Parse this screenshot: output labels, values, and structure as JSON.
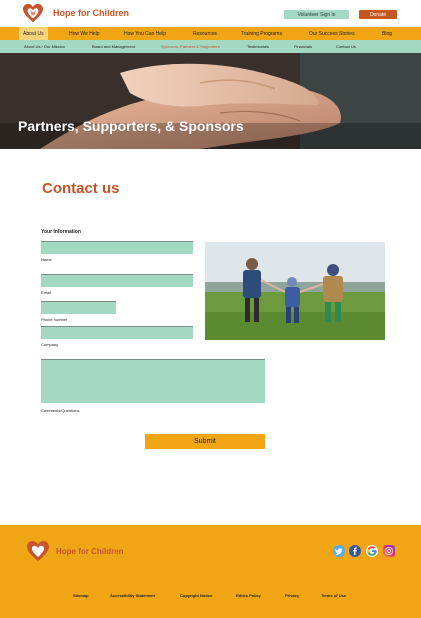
{
  "header": {
    "brand": "Hope for Children",
    "volunteer_label": "Volunteer Sign in",
    "donate_label": "Donate"
  },
  "main_nav": [
    {
      "label": "About Us",
      "active": true
    },
    {
      "label": "How We Help"
    },
    {
      "label": "How You Can Help"
    },
    {
      "label": "Resources"
    },
    {
      "label": "Training Programs"
    },
    {
      "label": "Our Success Stories"
    },
    {
      "label": "Blog"
    }
  ],
  "sub_nav": [
    {
      "label": "About Us / Our Mission"
    },
    {
      "label": "Board and Management"
    },
    {
      "label": "Sponsors, Partners & Supporters",
      "current": true
    },
    {
      "label": "Testimonials"
    },
    {
      "label": "Financials"
    },
    {
      "label": "Contact Us"
    }
  ],
  "hero": {
    "title": "Partners, Supporters, & Sponsors"
  },
  "contact": {
    "title": "Contact us",
    "section_label": "Your Information",
    "fields": {
      "name": "Name",
      "email": "Email",
      "phone": "Phone number",
      "company": "Company",
      "comments": "Comments/Questions"
    },
    "submit_label": "Submit"
  },
  "footer": {
    "brand": "Hope for Children",
    "links": [
      "Sitemap",
      "Accessibility Statement",
      "Copyright Notice",
      "Ethics Policy",
      "Privacy",
      "Terms of Use"
    ]
  },
  "colors": {
    "accent_orange": "#f0a515",
    "brand_red": "#c8552a",
    "mint": "#a3d8c3"
  },
  "icons": [
    "heart-logo-icon",
    "twitter-icon",
    "facebook-icon",
    "google-icon",
    "instagram-icon"
  ]
}
